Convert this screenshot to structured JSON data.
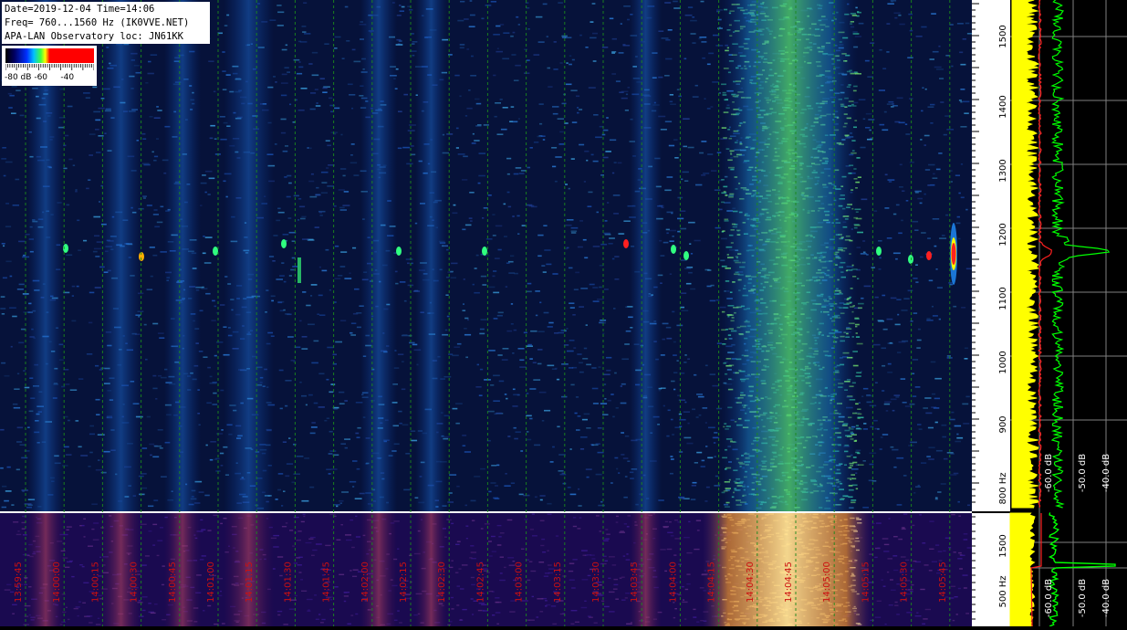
{
  "header": {
    "line1": "Date=2019-12-04 Time=14:06",
    "line2": "Freq= 760...1560 Hz (IK0VVE.NET)",
    "line3": "APA-LAN Observatory loc: JN61KK"
  },
  "color_scale": {
    "label_a": "-80 dB",
    "label_b": "-60",
    "label_c": "-40"
  },
  "freq_axis_top": {
    "labels": [
      "1500",
      "1400",
      "1300",
      "1200",
      "1100",
      "1000",
      "900",
      "800 Hz"
    ]
  },
  "freq_axis_bottom": {
    "labels": [
      "1500",
      "500 Hz"
    ]
  },
  "level_axis": {
    "labels": [
      "-60.0 dB",
      "-50.0 dB",
      "-40.0 dB"
    ],
    "bottom_labels": [
      "-60.0 dB",
      "-50.0 dB",
      "-40.0 dB"
    ]
  },
  "time_axis": {
    "labels": [
      "13:59:45",
      "14:00:00",
      "14:00:15",
      "14:00:30",
      "14:00:45",
      "14:01:00",
      "14:01:15",
      "14:01:30",
      "14:01:45",
      "14:02:00",
      "14:02:15",
      "14:02:30",
      "14:02:45",
      "14:03:00",
      "14:03:15",
      "14:03:30",
      "14:03:45",
      "14:04:00",
      "14:04:15",
      "14:04:30",
      "14:04:45",
      "14:05:00",
      "14:05:15",
      "14:05:30",
      "14:05:45"
    ]
  },
  "colors": {
    "grid": "#1c8a1c",
    "spectrum_yellow": "#ffff00",
    "spectrum_green": "#00ff00",
    "peak_red": "#ff2020",
    "time_label": "#cc1010"
  }
}
